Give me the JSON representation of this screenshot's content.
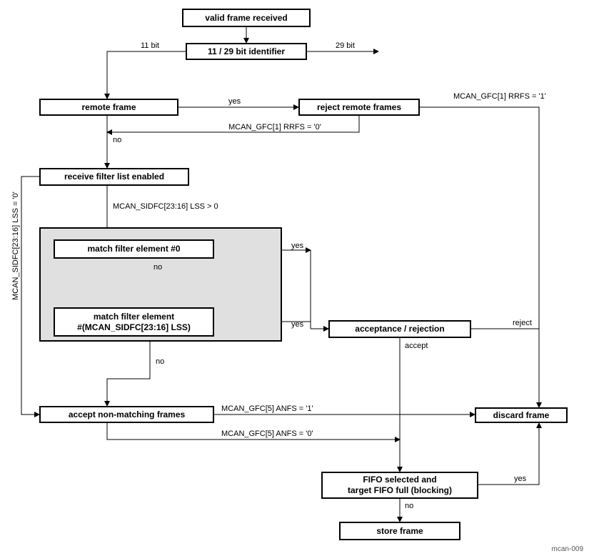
{
  "nodes": {
    "valid_frame": "valid frame received",
    "identifier": "11 / 29 bit identifier",
    "remote_frame": "remote frame",
    "reject_remote": "reject remote frames",
    "filter_list": "receive filter list enabled",
    "match0": "match filter element #0",
    "matchN_l1": "match filter element",
    "matchN_l2": "#(MCAN_SIDFC[23:16] LSS)",
    "accept_reject": "acceptance / rejection",
    "accept_nonmatch": "accept non-matching frames",
    "discard": "discard frame",
    "fifo_l1": "FIFO selected and",
    "fifo_l2": "target FIFO full (blocking)",
    "store": "store frame"
  },
  "labels": {
    "bit11": "11 bit",
    "bit29": "29 bit",
    "yes": "yes",
    "no": "no",
    "rrfs1": "MCAN_GFC[1] RRFS = '1'",
    "rrfs0": "MCAN_GFC[1] RRFS = '0'",
    "lss_gt0": "MCAN_SIDFC[23:16] LSS > 0",
    "lss_eq0": "MCAN_SIDFC[23:16] LSS = '0'",
    "anfs1": "MCAN_GFC[5] ANFS = '1'",
    "anfs0": "MCAN_GFC[5] ANFS = '0'",
    "reject": "reject",
    "accept": "accept"
  },
  "footer": "mcan-009"
}
